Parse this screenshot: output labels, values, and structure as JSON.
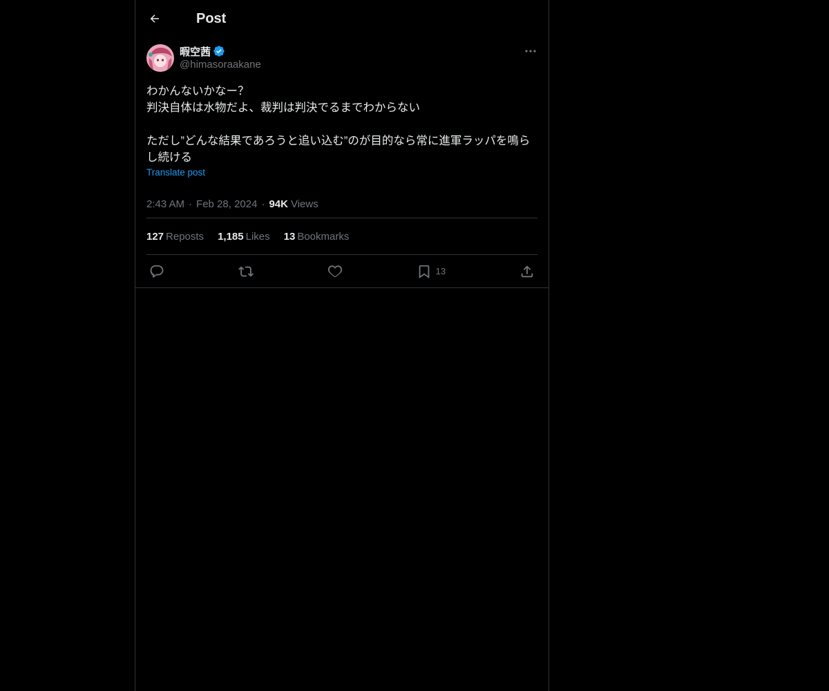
{
  "header": {
    "title": "Post"
  },
  "post": {
    "author": {
      "display_name": "暇空茜",
      "handle": "@himasoraakane"
    },
    "text": "わかんないかなー？\n判決自体は水物だよ、裁判は判決でるまでわからない\n\nただし”どんな結果であろうと追い込む”のが目的なら常に進軍ラッパを鳴らし続ける",
    "translate_label": "Translate post",
    "time": "2:43 AM",
    "date": "Feb 28, 2024",
    "views_count": "94K",
    "views_label": "Views",
    "separator": "·"
  },
  "stats": {
    "reposts_count": "127",
    "reposts_label": "Reposts",
    "likes_count": "1,185",
    "likes_label": "Likes",
    "bookmarks_count": "13",
    "bookmarks_label": "Bookmarks"
  },
  "actions": {
    "reply_icon": "reply-icon",
    "repost_icon": "repost-icon",
    "like_icon": "heart-icon",
    "bookmark_icon": "bookmark-icon",
    "bookmark_count": "13",
    "share_icon": "share-icon"
  },
  "colors": {
    "background": "#000000",
    "text": "#e7e9ea",
    "muted": "#71767b",
    "accent": "#1d9bf0",
    "border": "#2f3336"
  }
}
